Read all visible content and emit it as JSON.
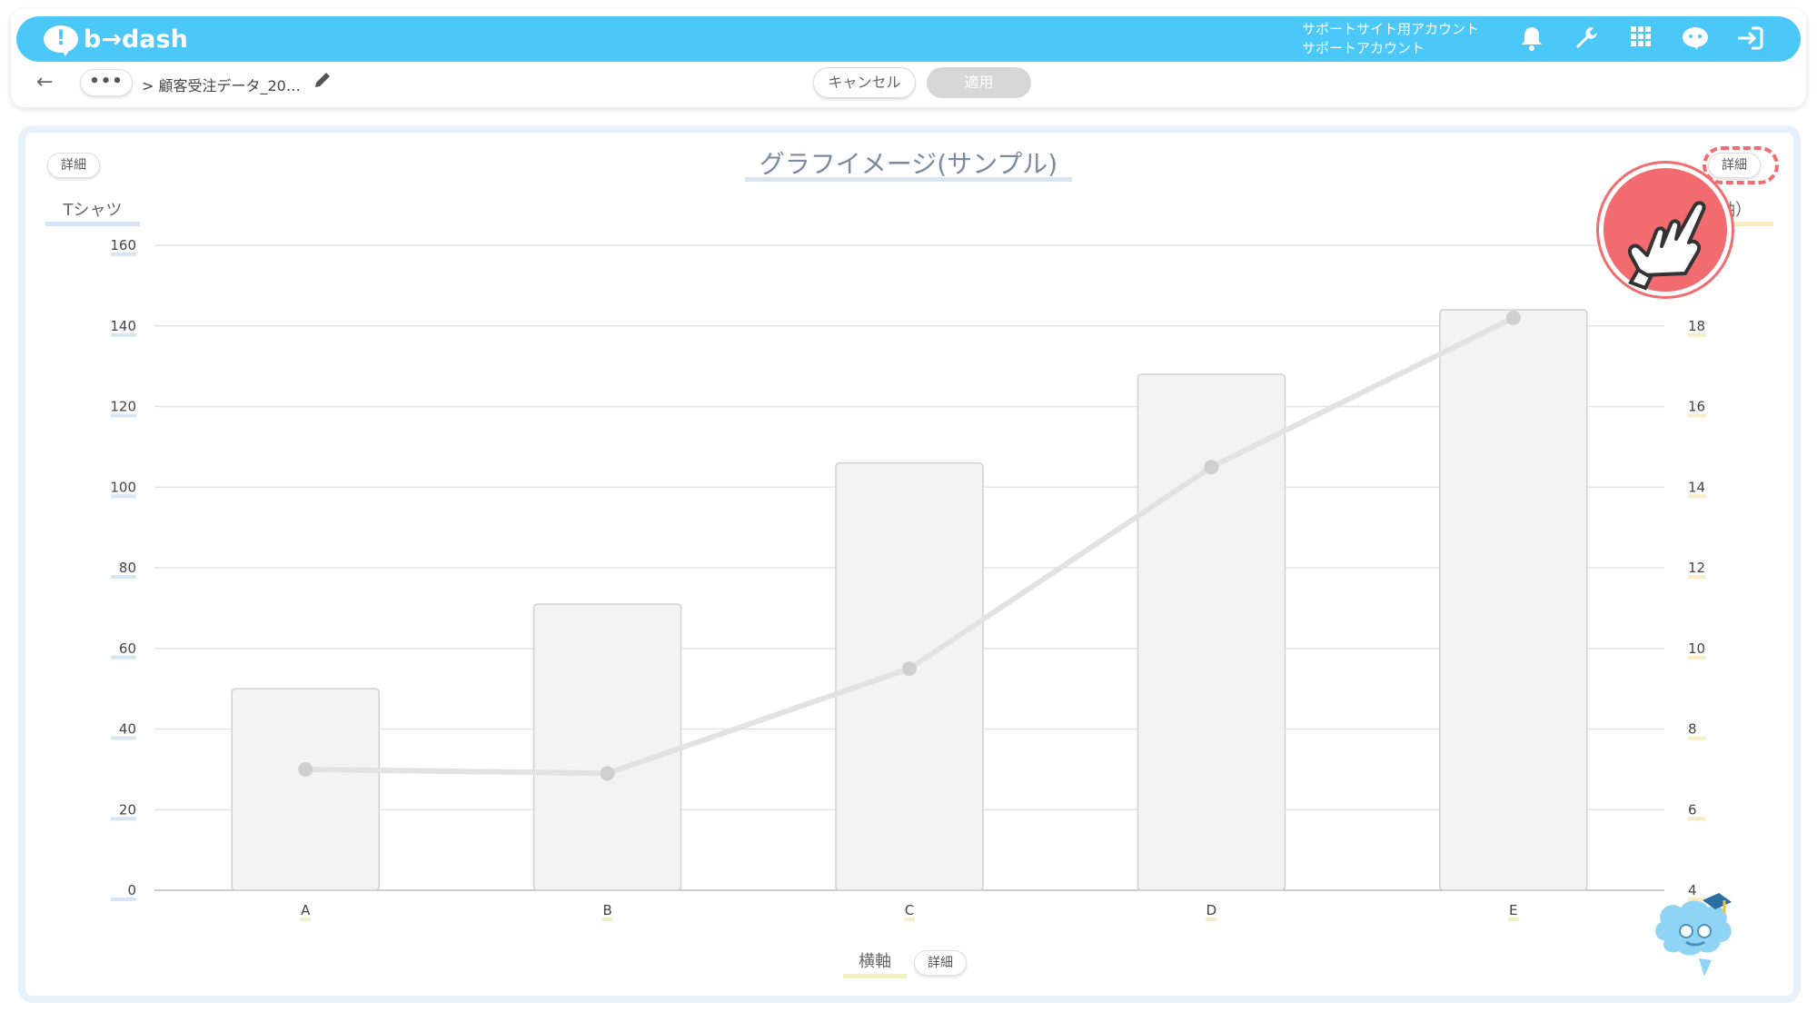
{
  "header": {
    "logo_text": "b→dash",
    "logo_mark": "!",
    "account_line1": "サポートサイト用アカウント",
    "account_line2": "サポートアカウント",
    "icons": [
      "bell-icon",
      "wrench-icon",
      "grid-icon",
      "mascot-chat-icon",
      "logout-icon"
    ],
    "color": "#4cc8f8"
  },
  "toolbar": {
    "back_glyph": "←",
    "more_label": "•••",
    "breadcrumb": "> 顧客受注データ_20…",
    "cancel_label": "キャンセル",
    "apply_label": "適用"
  },
  "panel": {
    "detail_left": "詳細",
    "detail_right": "詳細",
    "detail_xaxis": "詳細",
    "right_axis_label": "軸）"
  },
  "chart_data": {
    "type": "bar",
    "title": "グラフイメージ(サンプル)",
    "categories": [
      "A",
      "B",
      "C",
      "D",
      "E"
    ],
    "ylabel": "Tシャツ",
    "xlabel": "横軸",
    "ylim": [
      0,
      160
    ],
    "yticks": [
      0,
      20,
      40,
      60,
      80,
      100,
      120,
      140,
      160
    ],
    "y2lim": [
      4,
      20
    ],
    "y2ticks": [
      4,
      6,
      8,
      10,
      12,
      14,
      16,
      18
    ],
    "series": [
      {
        "type": "bar",
        "axis": "left",
        "values": [
          50,
          71,
          106,
          128,
          144
        ],
        "color": "#f3f3f3"
      },
      {
        "type": "line",
        "axis": "right",
        "values": [
          7.0,
          6.9,
          9.5,
          14.5,
          18.2
        ],
        "color": "#d9d9d9"
      }
    ],
    "grid": true
  }
}
